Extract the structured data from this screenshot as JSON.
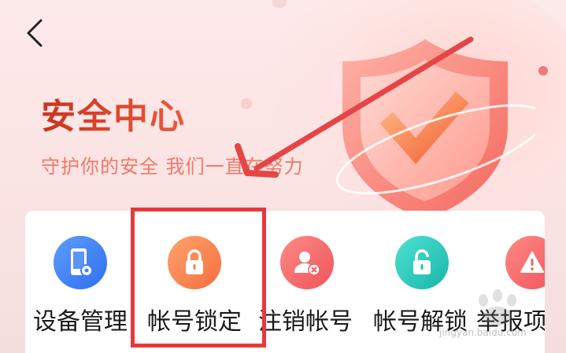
{
  "header": {
    "back_icon": "chevron-left-icon"
  },
  "hero": {
    "title": "安全中心",
    "subtitle": "守护你的安全 我们一直在努力",
    "illustration_icon": "shield-check-icon"
  },
  "services": [
    {
      "label": "设备管理",
      "icon": "phone-gear-icon",
      "color": "#3f80f5"
    },
    {
      "label": "帐号锁定",
      "icon": "lock-icon",
      "color": "#f8804c"
    },
    {
      "label": "注销帐号",
      "icon": "user-remove-icon",
      "color": "#f25f63"
    },
    {
      "label": "帐号解锁",
      "icon": "unlock-icon",
      "color": "#22c0b3"
    },
    {
      "label": "举报项",
      "icon": "alert-icon",
      "color": "#f25f63"
    }
  ],
  "annotation": {
    "arrow_color": "#e64545",
    "highlight_color": "#e9383a"
  },
  "watermark": {
    "text": "jingyan.baidu.com"
  }
}
